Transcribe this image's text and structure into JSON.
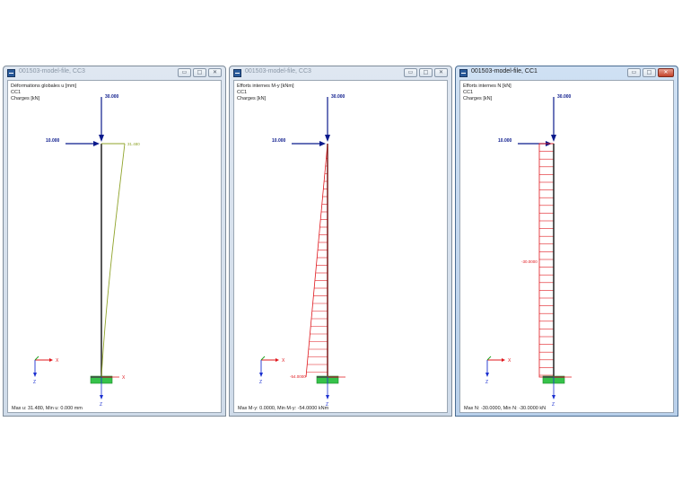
{
  "windows": [
    {
      "title": "001503-model-file, CC3",
      "active": false,
      "info_lines": [
        "Déformations globales u [mm]",
        "CC1",
        "Charges [kN]"
      ],
      "load_vertical": "30.000",
      "load_horizontal": "10.000",
      "result_label": "31.480",
      "axis_x": "X",
      "axis_z": "Z",
      "status": "Max u: 31.480, Min u: 0.000 mm"
    },
    {
      "title": "001503-model-file, CC3",
      "active": false,
      "info_lines": [
        "Efforts internes M-y [kNm]",
        "CC1",
        "Charges [kN]"
      ],
      "load_vertical": "30.000",
      "load_horizontal": "10.000",
      "result_label": "-54.0000",
      "axis_x": "X",
      "axis_z": "Z",
      "status": "Max M-y: 0.0000, Min M-y: -54.0000 kNm"
    },
    {
      "title": "001503-model-file, CC1",
      "active": true,
      "info_lines": [
        "Efforts internes N [kN]",
        "CC1",
        "Charges [kN]"
      ],
      "load_vertical": "30.000",
      "load_horizontal": "10.000",
      "result_label": "-30.0000",
      "axis_x": "X",
      "axis_z": "Z",
      "status": "Max N: -30.0000, Min N: -30.0000 kN"
    }
  ],
  "colors": {
    "load": "#0b1a8c",
    "deformation": "#8fa32a",
    "internal_force": "#e0181e",
    "support": "#36c24a",
    "axis_x": "#e0181e",
    "axis_y": "#1aa01a",
    "axis_z": "#1a2fd0"
  }
}
